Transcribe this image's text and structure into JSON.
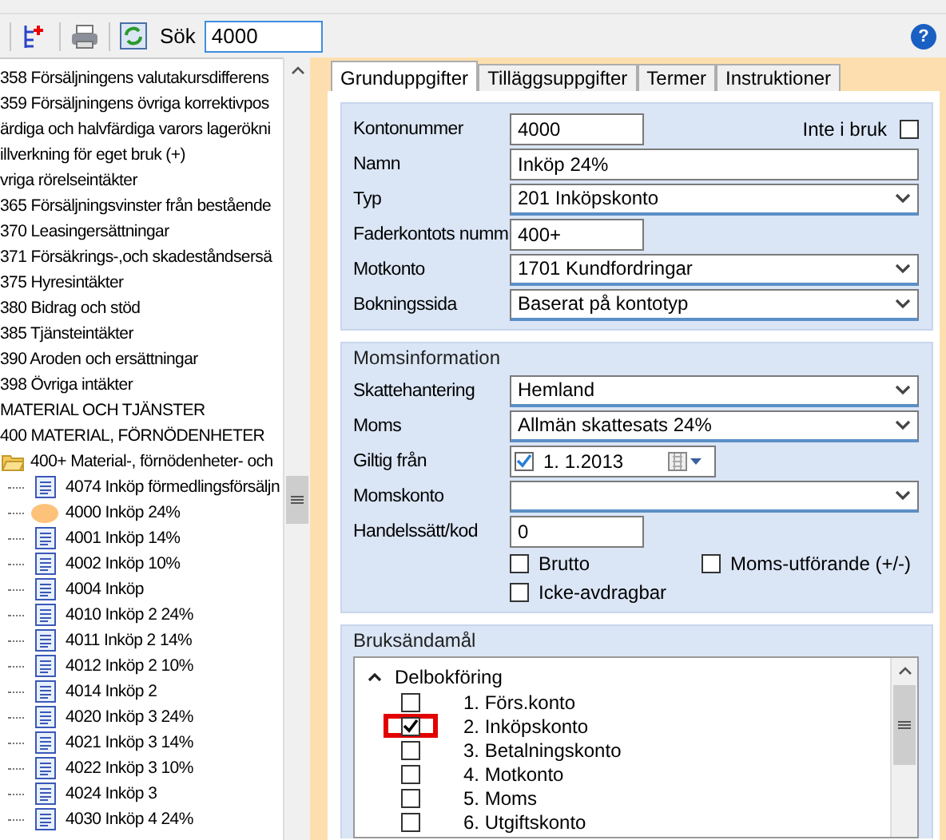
{
  "toolbar": {
    "search_label": "Sök",
    "search_value": "4000",
    "help": "?"
  },
  "tree": {
    "items": [
      {
        "label": "358 Försäljningens valutakursdifferens"
      },
      {
        "label": "359 Försäljningens övriga korrektivpos"
      },
      {
        "label": "ärdiga och halvfärdiga varors lagerökni"
      },
      {
        "label": "illverkning för eget bruk (+)"
      },
      {
        "label": "vriga rörelseintäkter"
      },
      {
        "label": "365 Försäljningsvinster från bestående"
      },
      {
        "label": "370 Leasingersättningar"
      },
      {
        "label": "371 Försäkrings-,och skadeståndsersä"
      },
      {
        "label": "375 Hyresintäkter"
      },
      {
        "label": "380 Bidrag och stöd"
      },
      {
        "label": "385 Tjänsteintäkter"
      },
      {
        "label": "390 Aroden och ersättningar"
      },
      {
        "label": "398 Övriga intäkter"
      },
      {
        "label": "MATERIAL OCH TJÄNSTER"
      },
      {
        "label": "400 MATERIAL, FÖRNÖDENHETER"
      },
      {
        "label": "400+ Material-, förnödenheter- och",
        "expanded": true,
        "children": [
          {
            "label": "4074 Inköp förmedlingsförsäljn",
            "selected": false
          },
          {
            "label": "4000 Inköp 24%",
            "selected": true
          },
          {
            "label": "4001 Inköp 14%",
            "selected": false
          },
          {
            "label": "4002 Inköp 10%",
            "selected": false
          },
          {
            "label": "4004 Inköp",
            "selected": false
          },
          {
            "label": "4010 Inköp 2 24%",
            "selected": false
          },
          {
            "label": "4011 Inköp 2 14%",
            "selected": false
          },
          {
            "label": "4012 Inköp 2 10%",
            "selected": false
          },
          {
            "label": "4014 Inköp 2",
            "selected": false
          },
          {
            "label": "4020 Inköp 3 24%",
            "selected": false
          },
          {
            "label": "4021 Inköp 3 14%",
            "selected": false
          },
          {
            "label": "4022 Inköp 3 10%",
            "selected": false
          },
          {
            "label": "4024 Inköp 3",
            "selected": false
          },
          {
            "label": "4030 Inköp 4 24%",
            "selected": false
          }
        ]
      }
    ]
  },
  "tabs": [
    {
      "label": "Grunduppgifter",
      "selected": true
    },
    {
      "label": "Tilläggsuppgifter",
      "selected": false
    },
    {
      "label": "Termer",
      "selected": false
    },
    {
      "label": "Instruktioner",
      "selected": false
    }
  ],
  "general": {
    "inactive": {
      "label": "Inte i bruk",
      "checked": false
    },
    "fields": [
      {
        "label": "Kontonummer",
        "kind": "short",
        "value": "4000"
      },
      {
        "label": "Namn",
        "kind": "wide",
        "value": "Inköp 24%"
      },
      {
        "label": "Typ",
        "kind": "select",
        "value": "201 Inköpskonto"
      },
      {
        "label": "Faderkontots numm",
        "kind": "short",
        "value": "400+"
      },
      {
        "label": "Motkonto",
        "kind": "select",
        "value": "1701 Kundfordringar"
      },
      {
        "label": "Bokningssida",
        "kind": "select",
        "value": "Baserat på kontotyp"
      }
    ]
  },
  "vat": {
    "title": "Momsinformation",
    "fields": [
      {
        "label": "Skattehantering",
        "kind": "select",
        "value": "Hemland"
      },
      {
        "label": "Moms",
        "kind": "select",
        "value": "Allmän skattesats 24%"
      },
      {
        "label": "Giltig från",
        "kind": "date",
        "value": "1.  1.2013",
        "checked": true
      },
      {
        "label": "Momskonto",
        "kind": "select"
      },
      {
        "label": "Handelssätt/kod",
        "kind": "short",
        "value": "0"
      }
    ],
    "checkboxes": [
      {
        "label": "Brutto",
        "checked": false
      },
      {
        "label": "Moms-utförande (+/-)",
        "checked": false
      },
      {
        "label": "Icke-avdragbar",
        "checked": false
      }
    ]
  },
  "purpose": {
    "title": "Bruksändamål",
    "group": {
      "label": "Delbokföring",
      "expanded": true,
      "children": [
        {
          "label": "1. Förs.konto",
          "checked": false,
          "highlighted": false
        },
        {
          "label": "2. Inköpskonto",
          "checked": true,
          "highlighted": true
        },
        {
          "label": "3. Betalningskonto",
          "checked": false,
          "highlighted": false
        },
        {
          "label": "4. Motkonto",
          "checked": false,
          "highlighted": false
        },
        {
          "label": "5. Moms",
          "checked": false,
          "highlighted": false
        },
        {
          "label": "6. Utgiftskonto",
          "checked": false,
          "highlighted": false
        }
      ]
    }
  }
}
